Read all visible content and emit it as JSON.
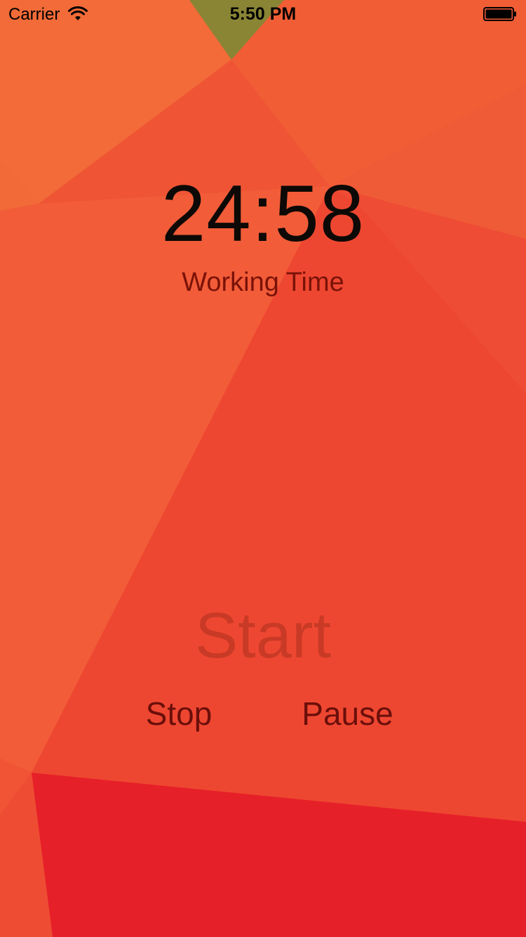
{
  "status_bar": {
    "carrier": "Carrier",
    "time": "5:50 PM",
    "wifi_icon": "wifi-icon",
    "battery_icon": "battery-full-icon"
  },
  "timer": {
    "time_remaining": "24:58",
    "mode_label": "Working Time"
  },
  "controls": {
    "start_label": "Start",
    "stop_label": "Stop",
    "pause_label": "Pause"
  },
  "colors": {
    "background_base": "#f05a35",
    "timer_text": "#0d0906",
    "mode_text": "#7a1208",
    "start_text": "#c93a26",
    "control_text": "#6b0f0a",
    "accent_red": "#e62028",
    "accent_olive": "#8a8535"
  }
}
